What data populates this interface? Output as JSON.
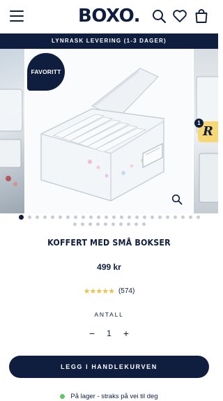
{
  "header": {
    "logo": "BOXO."
  },
  "promo": {
    "text": "LYNRASK LEVERING (1-3 DAGER)"
  },
  "gallery": {
    "badge": "FAVORITT",
    "review_widget_count": "1",
    "review_widget_letter": "R",
    "slide_count": 34,
    "active_slide": 1
  },
  "product": {
    "title": "KOFFERT MED SMÅ BOKSER",
    "price": "499 kr",
    "rating_value": 4.5,
    "stars": "★★★★★",
    "review_count": "(574)",
    "quantity_label": "ANTALL",
    "quantity": "1",
    "decrement": "−",
    "increment": "+",
    "add_to_cart": "LEGG I HANDLEKURVEN",
    "stock_text": "På lager - straks på vei til deg"
  },
  "colors": {
    "brand_navy": "#0f1d3f",
    "star_gold": "#e9c24b",
    "stock_green": "#63c36a",
    "review_widget_yellow": "#f7d774"
  }
}
